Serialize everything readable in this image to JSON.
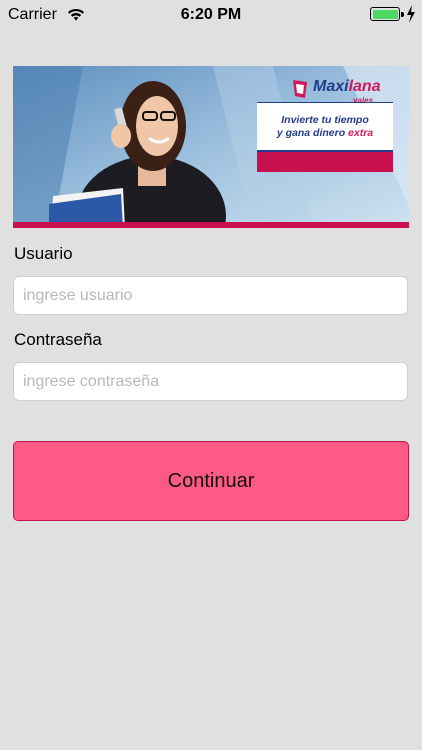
{
  "status_bar": {
    "carrier": "Carrier",
    "time": "6:20 PM",
    "icons": [
      "wifi-icon",
      "battery-icon",
      "charging-bolt-icon"
    ],
    "battery_color": "#4cd964"
  },
  "banner": {
    "brand_name_main": "Maxi",
    "brand_name_accent": "lana",
    "brand_sub": "vales",
    "tagline_line1": "Invierte tu tiempo",
    "tagline_line2": "y gana dinero",
    "tagline_extra": "extra",
    "accent_color": "#c8104f",
    "brand_color": "#233b8c"
  },
  "form": {
    "user_label": "Usuario",
    "user_placeholder": "ingrese usuario",
    "user_value": "",
    "password_label": "Contraseña",
    "password_placeholder": "ingrese contraseña",
    "password_value": "",
    "submit_label": "Continuar",
    "submit_color": "#ff5a85"
  }
}
